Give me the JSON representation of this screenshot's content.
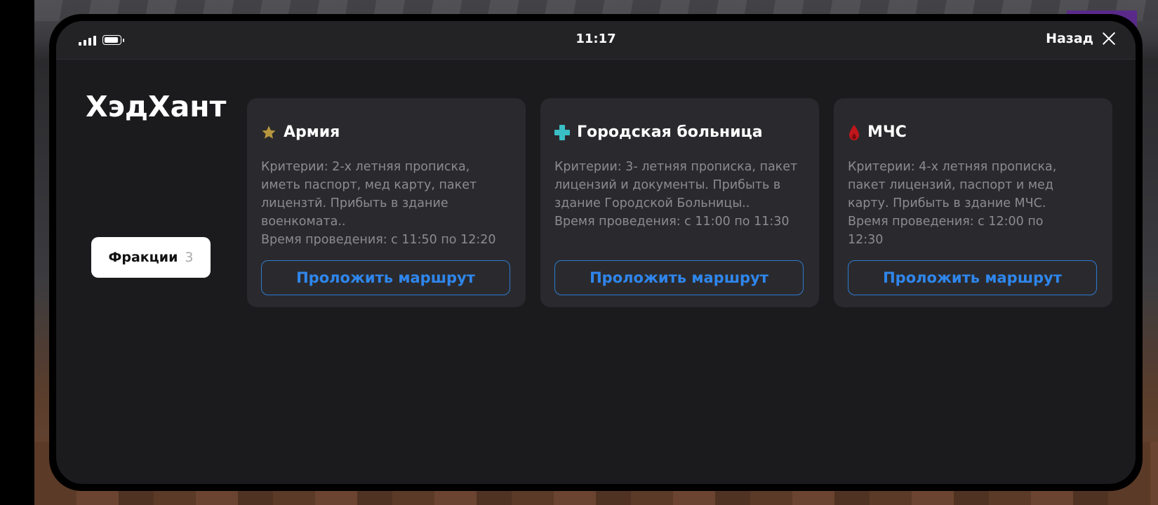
{
  "statusbar": {
    "time": "11:17",
    "back_label": "Назад"
  },
  "app": {
    "title": "ХэдХант"
  },
  "tabs": [
    {
      "label": "Фракции",
      "count": "3"
    }
  ],
  "cards": [
    {
      "icon": "star-icon",
      "title": "Армия",
      "text": "Критерии: 2-х летняя прописка,\nиметь паспорт, мед карту, пакет\nлицензтй. Прибыть в здание\nвоенкомата..\nВремя проведения: с 11:50 по 12:20",
      "button": "Проложить маршрут"
    },
    {
      "icon": "medical-cross-icon",
      "title": "Городская больница",
      "text": "Критерии: 3- летняя прописка, пакет\nлицензий и документы. Прибыть в\nздание Городской Больницы..\nВремя проведения: с 11:00 по 11:30",
      "button": "Проложить маршрут"
    },
    {
      "icon": "fire-drop-icon",
      "title": "МЧС",
      "text": "Критерии:  4-х летняя прописка,\nпакет лицензий, паспорт и мед\nкарту. Прибыть в здание МЧС.\nВремя проведения: с 12:00 по\n12:30",
      "button": "Проложить маршрут"
    }
  ],
  "colors": {
    "accent": "#2f86ec",
    "star": "#b8963e",
    "cross": "#3bbfc6",
    "drop": "#c0161c",
    "background": "#1b1b1e",
    "card": "#2a2a2e"
  }
}
